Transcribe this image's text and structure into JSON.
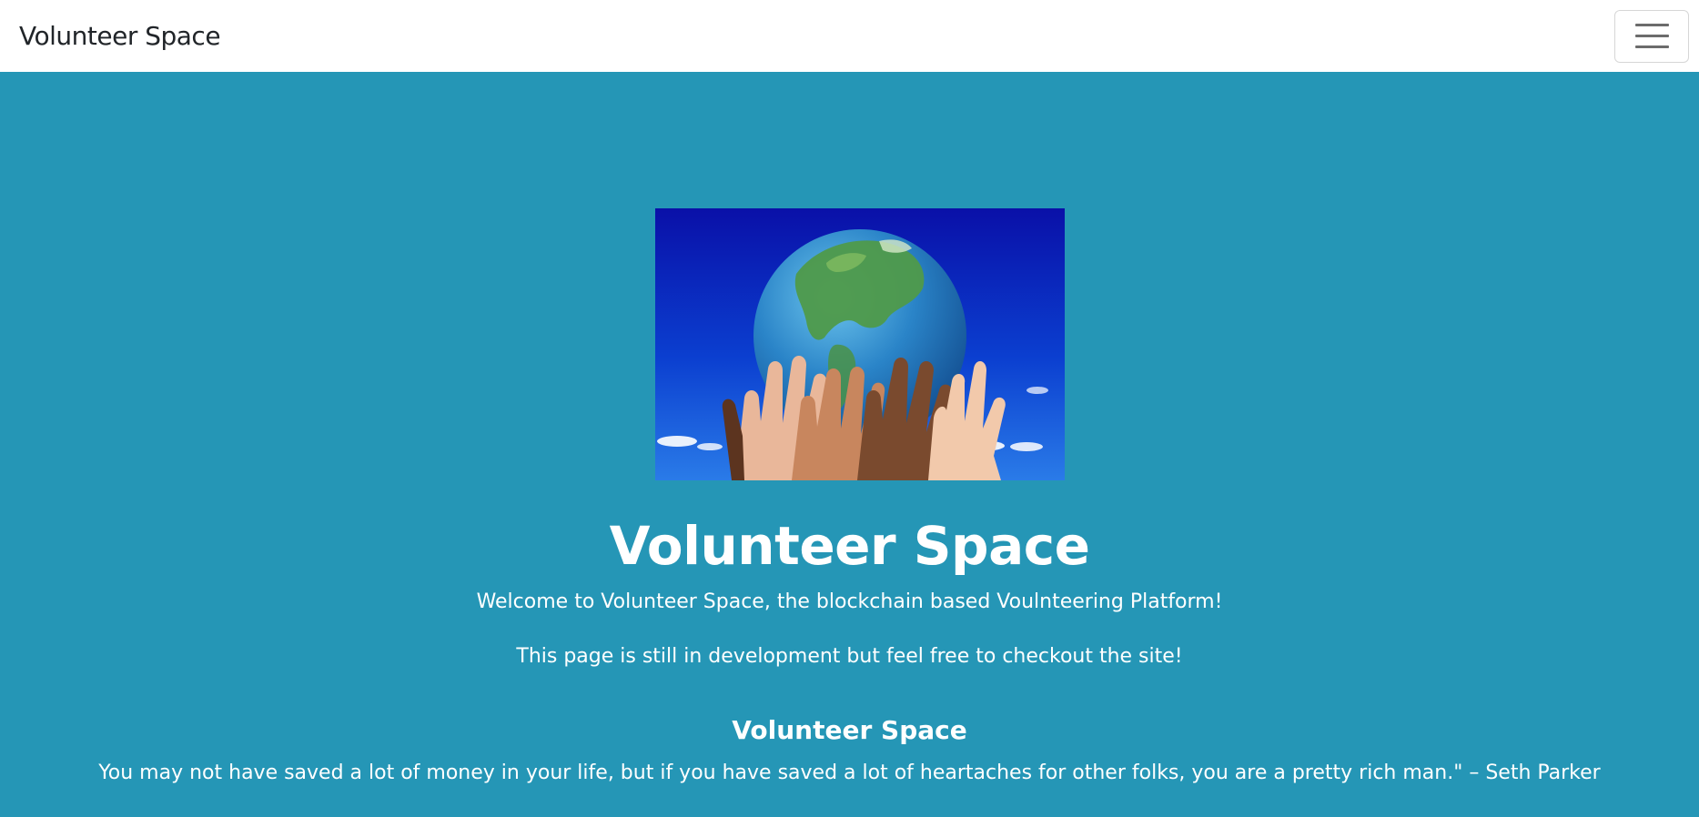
{
  "navbar": {
    "brand": "Volunteer Space",
    "toggler_icon": "hamburger-menu-icon"
  },
  "hero": {
    "image_subject": "hands-holding-globe",
    "title": "Volunteer Space",
    "welcome": "Welcome to Volunteer Space, the blockchain based Voulnteering Platform!",
    "dev_notice": "This page is still in development but feel free to checkout the site!",
    "quote_title": "Volunteer Space",
    "quote": "You may not have saved a lot of money in your life, but if you have saved a lot of heartaches for other folks, you are a pretty rich man.\" – Seth Parker"
  },
  "colors": {
    "hero_background": "#2596b6",
    "navbar_background": "#ffffff",
    "text_light": "#ffffff",
    "brand_text": "#212529"
  }
}
